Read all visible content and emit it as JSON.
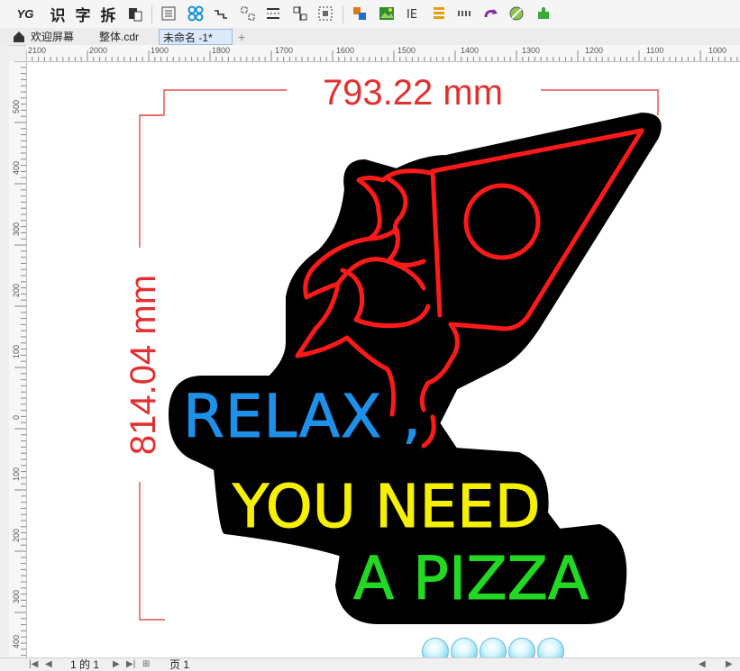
{
  "toolbar": {
    "logo": "YG",
    "btn_recognize": "识",
    "btn_char": "字",
    "btn_split": "拆",
    "icons": [
      "clipboard-icon",
      "list-icon",
      "node-pattern-icon",
      "wave-align-icon",
      "dotted-align-icon",
      "text-lines-icon",
      "grid-align-icon",
      "select-frame-icon",
      "layer-icon",
      "image-icon",
      "text-frame-icon",
      "stack-icon",
      "dots-icon",
      "redo-arrow-icon",
      "disc-icon",
      "puzzle-icon"
    ]
  },
  "tabs": {
    "home_icon": "home-icon",
    "welcome": "欢迎屏幕",
    "file1": "整体.cdr",
    "active": "未命名 -1*",
    "add": "+"
  },
  "hruler": {
    "labels": [
      "2100",
      "2000",
      "1900",
      "1800",
      "1700",
      "1600",
      "1500",
      "1400",
      "1300",
      "1200",
      "1100",
      "1000"
    ]
  },
  "vruler": {
    "labels": [
      "500",
      "400",
      "300",
      "200",
      "100",
      "0",
      "100",
      "200",
      "300",
      "400"
    ]
  },
  "canvas": {
    "width_dim": "793.22 mm",
    "height_dim": "814.04 mm",
    "line1": "RELAX ,",
    "line2": "YOU NEED",
    "line3": "A PIZZA",
    "colors": {
      "relax": "#1e90e8",
      "you_need": "#f5f000",
      "pizza": "#22d822",
      "neon_red": "#ff1a1a",
      "backing": "#000000",
      "dim": "#e23030"
    }
  },
  "status": {
    "page_of": "1 的 1",
    "page_tab": "页 1"
  }
}
